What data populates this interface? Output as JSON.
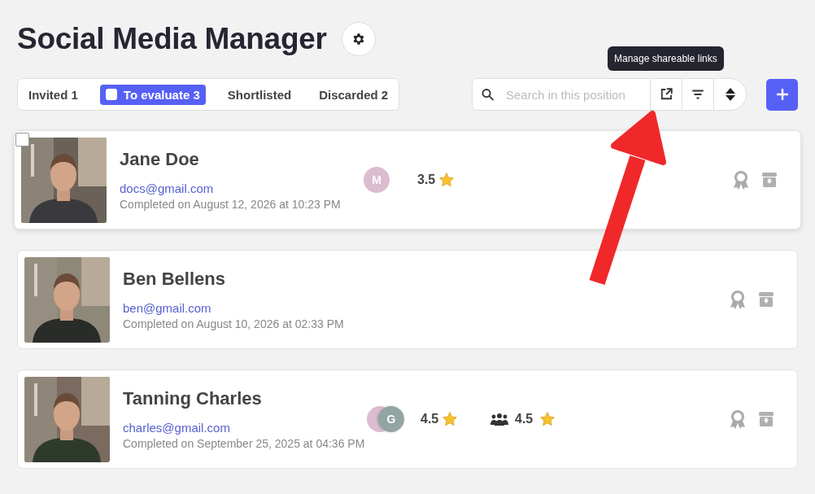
{
  "title": "Social Media Manager",
  "tabs": [
    {
      "label": "Invited 1",
      "selected": false
    },
    {
      "label": "To evaluate 3",
      "selected": true
    },
    {
      "label": "Shortlisted",
      "selected": false
    },
    {
      "label": "Discarded 2",
      "selected": false
    }
  ],
  "search": {
    "placeholder": "Search in this position"
  },
  "tooltip": "Manage shareable links",
  "candidates": [
    {
      "name": "Jane Doe",
      "email": "docs@gmail.com",
      "completed": "Completed on August 12, 2026 at 10:23 PM",
      "hovered": true,
      "checked": false,
      "reviewers": [
        {
          "initial": "M",
          "color": "#dcbcd0"
        }
      ],
      "rating": "3.5",
      "photo": {
        "kind": "picture"
      }
    },
    {
      "name": "Ben Bellens",
      "email": "ben@gmail.com",
      "completed": "Completed on August 10, 2026 at 02:33 PM",
      "hovered": false,
      "checked": false,
      "photo": {
        "kind": "picture"
      }
    },
    {
      "name": "Tanning Charles",
      "email": "charles@gmail.com",
      "completed": "Completed on September 25, 2025 at 04:36 PM",
      "hovered": false,
      "checked": false,
      "reviewers": [
        {
          "color": "#dcbcd0"
        },
        {
          "initial": "G",
          "color": "#92a5a2"
        }
      ],
      "rating": "4.5",
      "team_rating": "4.5",
      "photo": {
        "kind": "picture"
      }
    }
  ],
  "annotation": {
    "kind": "arrow"
  }
}
